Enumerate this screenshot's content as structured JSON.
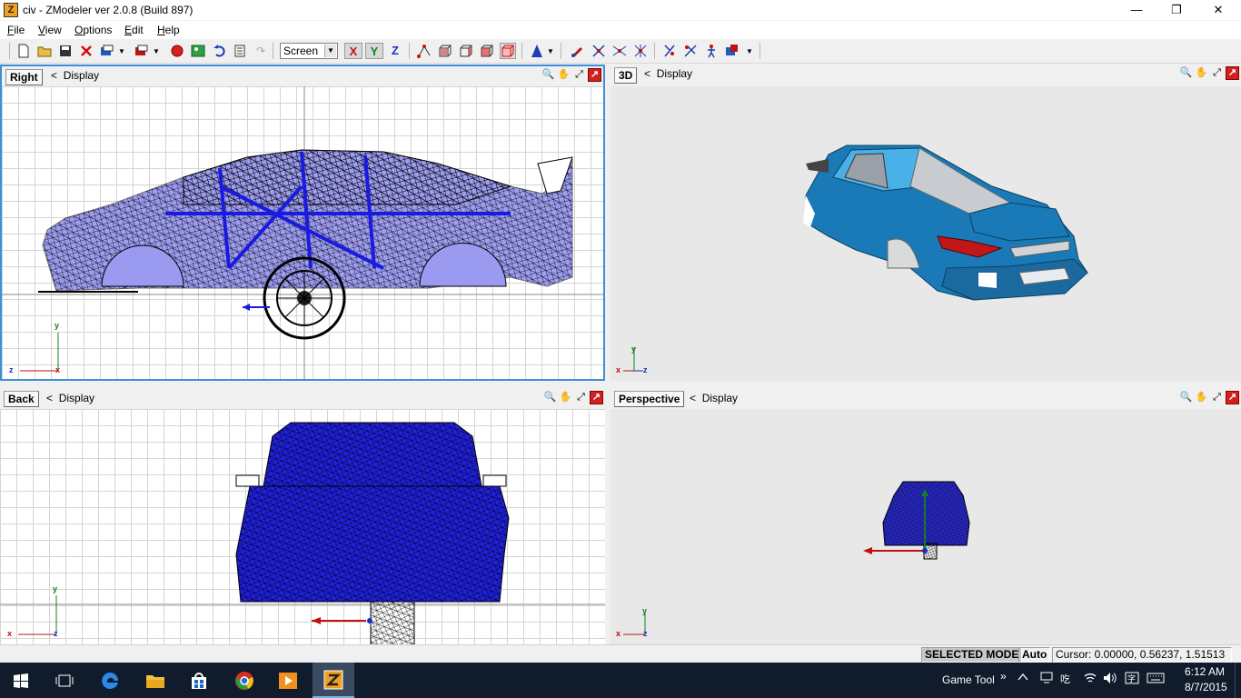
{
  "window": {
    "title": "civ - ZModeler ver 2.0.8 (Build 897)",
    "app_icon": "Z",
    "minimize": "—",
    "restore": "❐",
    "close": "✕"
  },
  "menu": [
    "File",
    "View",
    "Options",
    "Edit",
    "Help"
  ],
  "toolbar": {
    "mode_select": "Screen",
    "axis_x": "X",
    "axis_y": "Y",
    "axis_z": "Z",
    "icons": [
      "new-file-icon",
      "open-folder-icon",
      "save-icon",
      "delete-icon",
      "export-icon",
      "import-icon",
      "record-icon",
      "image-icon",
      "undo-icon",
      "notes-icon",
      "redo-icon",
      "select-vertex-icon",
      "select-box-icon",
      "select-cube-icon",
      "select-object-icon",
      "select-group-icon",
      "mirror-icon",
      "paint-icon",
      "cut-icon",
      "weld-icon",
      "align-icon",
      "light-icon",
      "bone-icon",
      "figure-icon",
      "render-icon"
    ]
  },
  "viewports": {
    "right": {
      "label": "Right",
      "display": "Display",
      "nav_back": "<",
      "axis_v": "y",
      "axis_h": "z",
      "axis_origin": "x"
    },
    "view3d": {
      "label": "3D",
      "display": "Display",
      "nav_back": "<",
      "axis_v": "y",
      "axis_h": "z",
      "axis_origin": "x"
    },
    "back": {
      "label": "Back",
      "display": "Display",
      "nav_back": "<",
      "axis_v": "y",
      "axis_h": "z",
      "axis_origin": "x"
    },
    "perspective": {
      "label": "Perspective",
      "display": "Display",
      "nav_back": "<",
      "axis_v": "y",
      "axis_h": "z",
      "axis_origin": "x"
    }
  },
  "status": {
    "mode": "SELECTED MODE",
    "auto": "Auto",
    "cursor": "Cursor: 0.00000, 0.56237, 1.51513"
  },
  "taskbar": {
    "game_tool": "Game Tool",
    "time": "6:12 AM",
    "date": "8/7/2015",
    "chevron": "»"
  },
  "colors": {
    "wire_blue": "#2020e0",
    "car_body": "#1a7ab8",
    "taskbar": "#101c2c",
    "selected_frame": "#3d8fd8"
  }
}
